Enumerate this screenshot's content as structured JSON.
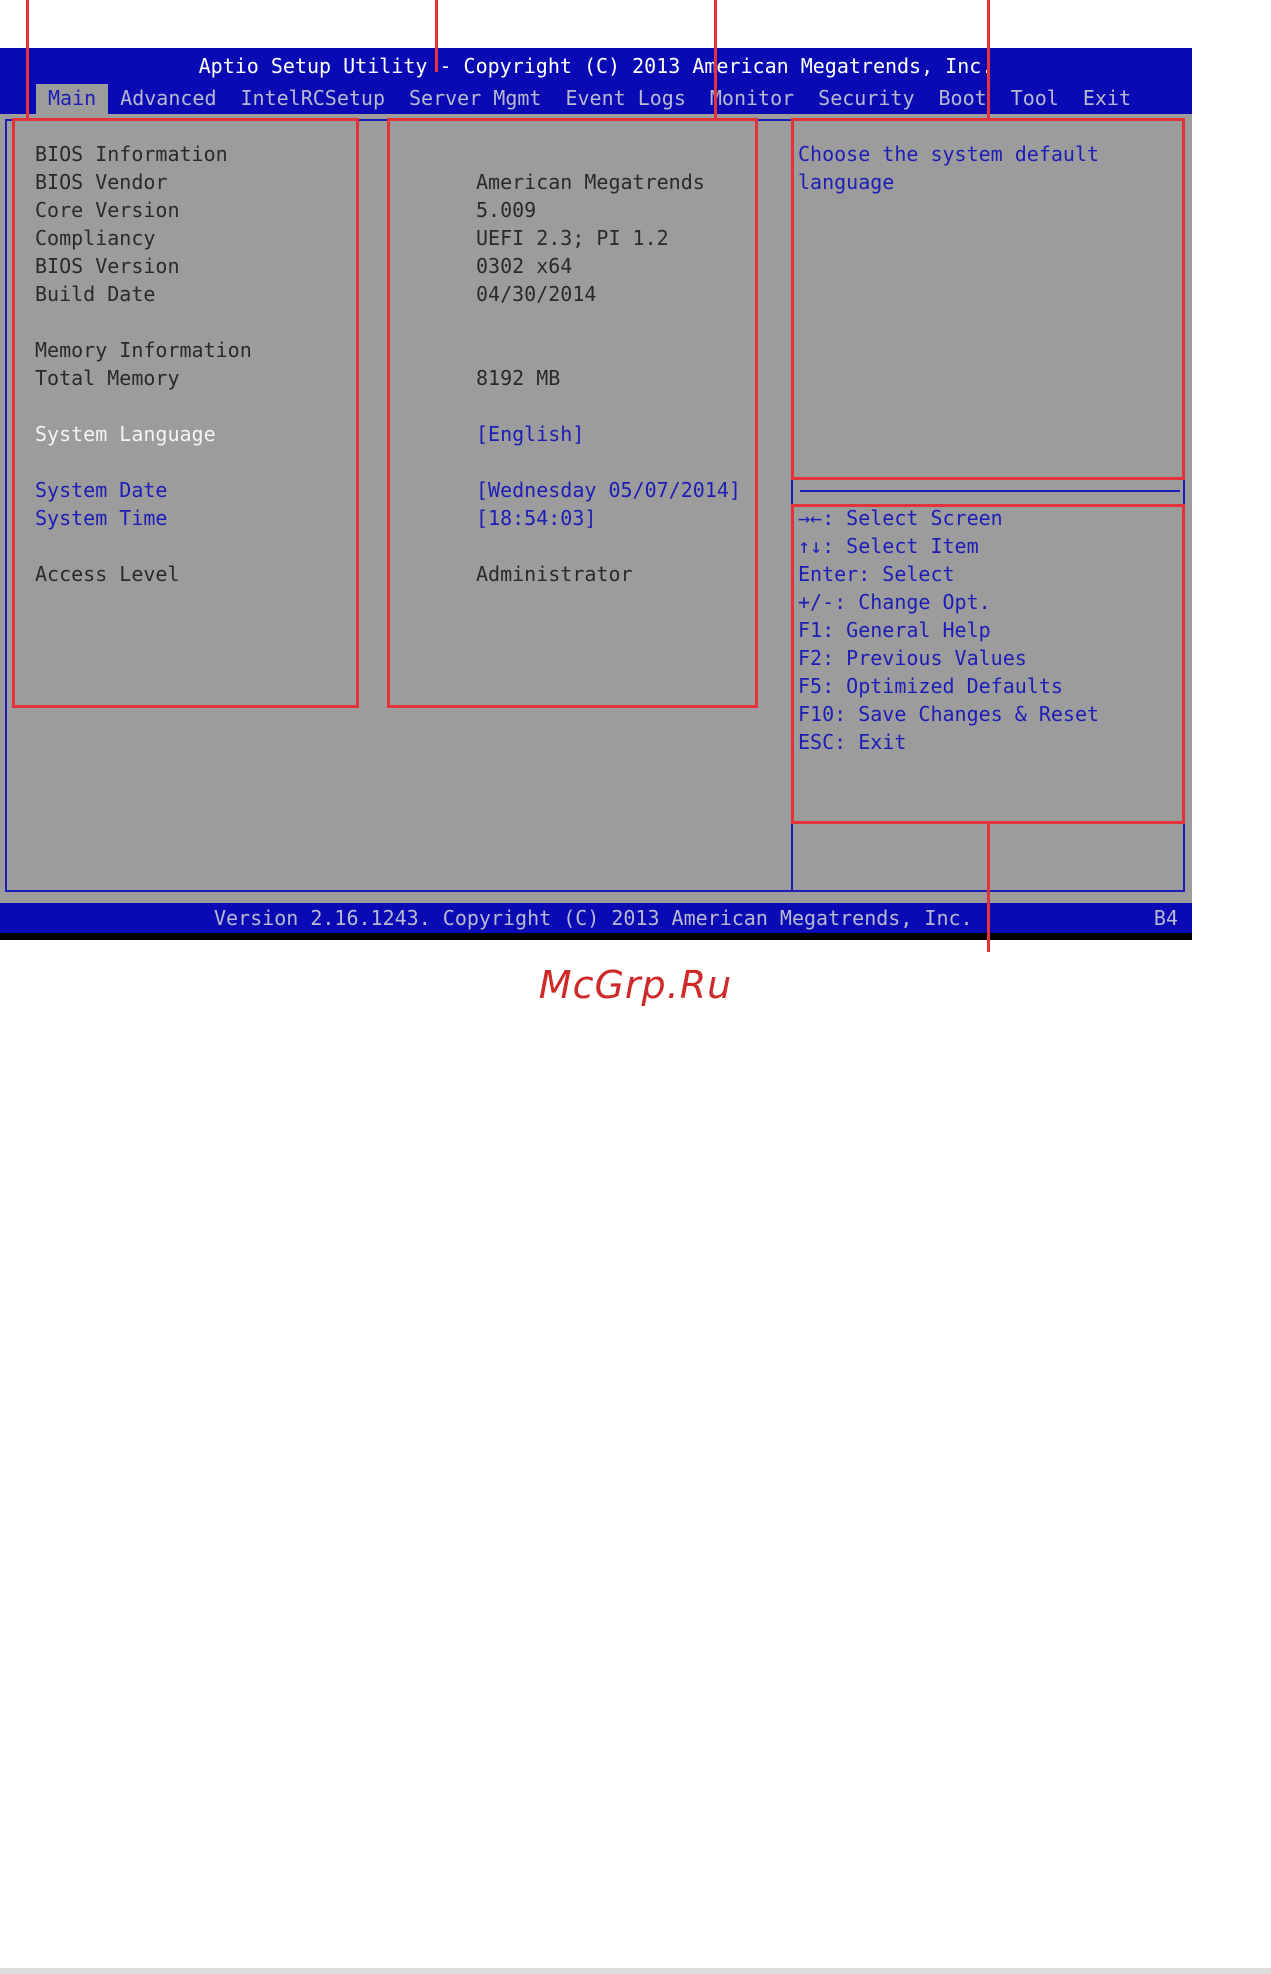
{
  "title": "Aptio Setup Utility - Copyright (C) 2013 American Megatrends, Inc.",
  "menu": [
    {
      "label": "Main",
      "active": true
    },
    {
      "label": "Advanced"
    },
    {
      "label": "IntelRCSetup"
    },
    {
      "label": "Server Mgmt"
    },
    {
      "label": "Event Logs"
    },
    {
      "label": "Monitor"
    },
    {
      "label": "Security"
    },
    {
      "label": "Boot"
    },
    {
      "label": "Tool"
    },
    {
      "label": "Exit"
    }
  ],
  "main": {
    "bios_info_heading": "BIOS Information",
    "bios_vendor_label": "BIOS Vendor",
    "bios_vendor_value": "American Megatrends",
    "core_version_label": "Core Version",
    "core_version_value": "5.009",
    "compliancy_label": "Compliancy",
    "compliancy_value": "UEFI 2.3; PI 1.2",
    "bios_version_label": "BIOS Version",
    "bios_version_value": "0302 x64",
    "build_date_label": "Build Date",
    "build_date_value": "04/30/2014",
    "memory_info_heading": "Memory Information",
    "total_memory_label": "Total Memory",
    "total_memory_value": "8192 MB",
    "system_language_label": "System Language",
    "system_language_value": "[English]",
    "system_date_label": "System Date",
    "system_date_value": "[Wednesday 05/07/2014]",
    "system_time_label": "System Time",
    "system_time_value": "[18:54:03]",
    "access_level_label": "Access Level",
    "access_level_value": "Administrator"
  },
  "help": {
    "line1": "Choose the system default",
    "line2": "language"
  },
  "keys": [
    "→←: Select Screen",
    "↑↓: Select Item",
    "Enter: Select",
    "+/-: Change Opt.",
    "F1: General Help",
    "F2: Previous Values",
    "F5: Optimized Defaults",
    "F10: Save Changes & Reset",
    "ESC: Exit"
  ],
  "status": {
    "text": "Version 2.16.1243. Copyright (C) 2013 American Megatrends, Inc.",
    "code": "B4"
  },
  "watermark": "McGrp.Ru",
  "colors": {
    "bios_blue": "#0a0ab4",
    "panel_gray": "#9c9c9c",
    "callout_red": "#e4323a"
  }
}
